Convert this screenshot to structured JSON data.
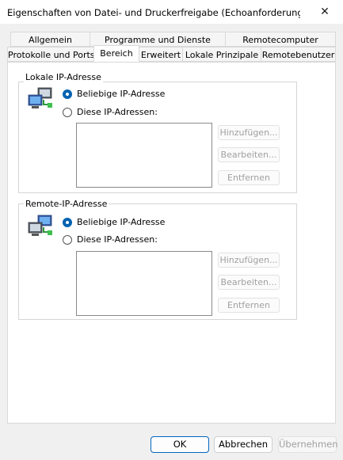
{
  "window": {
    "title": "Eigenschaften von Datei- und Druckerfreigabe (Echoanforderung - ICM...",
    "close_glyph": "✕"
  },
  "tabs_row1": [
    {
      "label": "Allgemein"
    },
    {
      "label": "Programme und Dienste"
    },
    {
      "label": "Remotecomputer"
    }
  ],
  "tabs_row2": [
    {
      "label": "Protokolle und Ports"
    },
    {
      "label": "Bereich",
      "active": true
    },
    {
      "label": "Erweitert"
    },
    {
      "label": "Lokale Prinzipale"
    },
    {
      "label": "Remotebenutzer"
    }
  ],
  "local": {
    "group_label": "Lokale IP-Adresse",
    "icon": "computer-network-icon",
    "radio_any": "Beliebige IP-Adresse",
    "radio_these": "Diese IP-Adressen:",
    "selected": "any",
    "buttons": {
      "add": "Hinzufügen...",
      "edit": "Bearbeiten...",
      "remove": "Entfernen"
    }
  },
  "remote": {
    "group_label": "Remote-IP-Adresse",
    "icon": "remote-computers-icon",
    "radio_any": "Beliebige IP-Adresse",
    "radio_these": "Diese IP-Adressen:",
    "selected": "any",
    "buttons": {
      "add": "Hinzufügen...",
      "edit": "Bearbeiten...",
      "remove": "Entfernen"
    }
  },
  "footer": {
    "ok": "OK",
    "cancel": "Abbrechen",
    "apply": "Übernehmen"
  },
  "colors": {
    "accent": "#0063b1",
    "disabled_text": "#a0a0a0"
  }
}
